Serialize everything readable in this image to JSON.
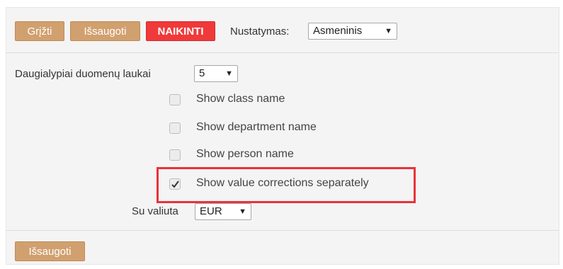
{
  "toolbar": {
    "back_label": "Grįžti",
    "save_label": "Išsaugoti",
    "delete_label": "NAIKINTI",
    "setting_label": "Nustatymas:",
    "setting_value": "Asmeninis"
  },
  "form": {
    "multi_fields_label": "Daugialypiai duomenų laukai",
    "multi_fields_value": "5",
    "checkboxes": [
      {
        "label": "Show class name",
        "checked": false
      },
      {
        "label": "Show department name",
        "checked": false
      },
      {
        "label": "Show person name",
        "checked": false
      },
      {
        "label": "Show value corrections separately",
        "checked": true
      }
    ],
    "currency_label": "Su valiuta",
    "currency_value": "EUR"
  },
  "footer": {
    "save_label": "Išsaugoti"
  },
  "colors": {
    "button_brown": "#d1a06f",
    "button_red": "#f0393a",
    "highlight_red": "#e8333a",
    "panel_bg": "#f4f4f4"
  },
  "icons": {
    "dropdown_arrow": "chevron-down-icon",
    "checkmark": "check-icon"
  }
}
